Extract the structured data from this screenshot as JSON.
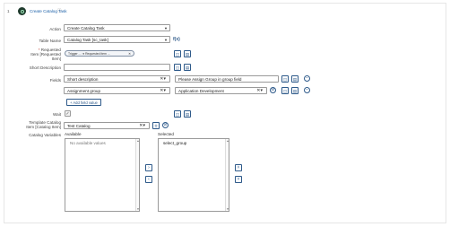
{
  "step": {
    "number": "1",
    "title": "Create Catalog Task",
    "info_icon": "info-circle-icon"
  },
  "form": {
    "action": {
      "label": "Action",
      "value": "Create Catalog Task"
    },
    "table_name": {
      "label": "Table Name",
      "value": "Catalog Task [sc_task]"
    },
    "requested_item": {
      "required_marker": "*",
      "label_line1": "Requested",
      "label_line2": "Item [Requested",
      "label_line3": "Item]",
      "pill_text": "Trigger ... ➔ Requested item ...",
      "pill_close": "✕"
    },
    "short_description": {
      "label": "Short Description",
      "value": ""
    },
    "fields": {
      "label": "Fields",
      "rows": [
        {
          "field": "Short description",
          "value": "Please Assign Group in group field"
        },
        {
          "field": "Assignment group",
          "value": "Application Development"
        }
      ],
      "add_label": "+ Add field value"
    },
    "wait": {
      "label": "Wait",
      "checked": "✓"
    },
    "template": {
      "label_line1": "Template Catalog",
      "label_line2": "Item [Catalog Item]",
      "value": "Test Catalog"
    },
    "catalog_variables": {
      "label": "Catalog Variables",
      "available_title": "Available",
      "available_items": [
        "No available values"
      ],
      "selected_title": "Selected",
      "selected_items": [
        "select_group"
      ]
    }
  },
  "colors": {
    "link": "#1a5fa8",
    "button": "#2e5a8a",
    "icon_bg": "#1f3b2d"
  }
}
